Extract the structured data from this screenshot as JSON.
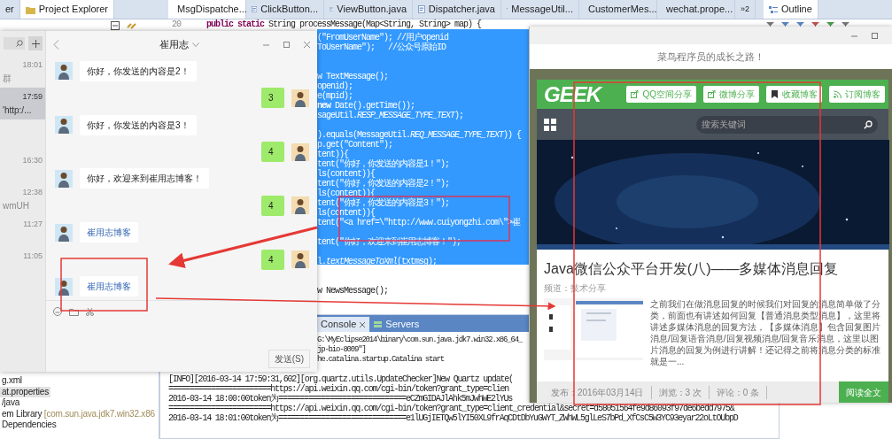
{
  "ide": {
    "left_tabs": [
      {
        "label": "er",
        "selected": false
      },
      {
        "label": "Project Explorer",
        "selected": true
      }
    ],
    "editor_tabs": [
      {
        "label": "MsgDispatche...",
        "selected": true
      },
      {
        "label": "ClickButton...",
        "selected": false
      },
      {
        "label": "ViewButton.java",
        "selected": false
      },
      {
        "label": "Dispatcher.java",
        "selected": false
      },
      {
        "label": "MessageUtil...",
        "selected": false
      },
      {
        "label": "CustomerMes...",
        "selected": false
      },
      {
        "label": "wechat.prope...",
        "selected": false
      }
    ],
    "tab_overflow": "»2",
    "outline_tab": "Outline",
    "code": {
      "line_number": "20",
      "header": "**public static** String processMessage(Map<String, String> map) {",
      "lines": [
        {
          "text": "(\"FromUserName\"); //用户openid",
          "selected": true
        },
        {
          "text": "ToUserName\");   //公众号原始ID",
          "selected": true
        },
        {
          "text": "w TextMessage();",
          "selected": true
        },
        {
          "text": "openid);",
          "selected": true
        },
        {
          "text": "e(mpid);",
          "selected": true
        },
        {
          "text": "**new** Date().getTime());",
          "selected": true
        },
        {
          "text": "sageUtil.*RESP_MESSAGE_TYPE_TEXT*);",
          "selected": true
        },
        {
          "text": ").equals(MessageUtil.*REQ_MESSAGE_TYPE_TEXT*)) {",
          "selected": true
        },
        {
          "text": "p.get(\"Content\");",
          "selected": true
        },
        {
          "text": "tent)){",
          "selected": true
        },
        {
          "text": "tent(\"你好，你发送的内容是1！\");",
          "selected": true
        },
        {
          "text": "ls(content)){",
          "selected": true
        },
        {
          "text": "tent(\"你好，你发送的内容是2！\");",
          "selected": true
        },
        {
          "text": "ls(content)){",
          "selected": true
        },
        {
          "text": "tent(\"你好，你发送的内容是3！\");",
          "selected": true
        },
        {
          "text": "ls(content)){",
          "selected": true
        },
        {
          "text": "tent(\"<a href=\\\"http://www.cuiyongzhi.com\\\">崔",
          "selected": true
        },
        {
          "text": "tent(\"你好，欢迎来到崔用志博客！\");",
          "selected": true
        },
        {
          "text": "l.*textMessageToXml*(txtmsg);",
          "selected": true
        },
        {
          "text": "w NewsMessage();",
          "selected": false
        }
      ]
    },
    "console": {
      "tabs": [
        {
          "label": "Console",
          "selected": true
        },
        {
          "label": "Servers",
          "selected": false
        }
      ],
      "header_lines": [
        "G:\\MyEclipse2014\\binary\\com.sun.java.jdk7.win32.x86_64_",
        "jp-bio-8009\"]",
        "he.catalina.startup.Catalina start"
      ],
      "log_lines": [
        "[INFO][2016-03-14 17:59:31,602][org.quartz.utils.UpdateChecker]New Quartz update(",
        "========================https://api.weixin.qq.com/cgi-bin/token?grant_type=clien",
        "2016-03-14 18:00:00token为==============================eCZmGIDAJlAhk5mJwhWE2lYUs",
        "========================https://api.weixin.qq.com/cgi-bin/token?grant_type=client_credential&secret=d58051564fe9d86093f97de6bedd7975&",
        "2016-03-14 18:01:00token为==============================e1lUGjIETQw5lYI50XL9frAqCDtDbYuGWYT_ZWhWL5glLeS7bPd_XfCsC5W3YC93eyar22oLtOUbpD"
      ]
    },
    "project_tree": [
      {
        "label": "g.xml",
        "selected": false
      },
      {
        "label": "at.properties",
        "selected": true
      },
      {
        "label": "/java",
        "selected": false
      },
      {
        "label": "em Library",
        "detail": "[com.sun.java.jdk7.win32.x86",
        "selected": false
      },
      {
        "label": "Dependencies",
        "selected": false
      }
    ]
  },
  "chat_window": {
    "title": "崔用志",
    "conversations": [
      {
        "time": "18:01",
        "preview": "群",
        "selected": false
      },
      {
        "time": "17:59",
        "preview": "'http:/...",
        "selected": true
      },
      {
        "time": "16:30",
        "selected": false
      },
      {
        "time": "12:38",
        "preview": "wmUH",
        "selected": false
      },
      {
        "time": "11:27",
        "selected": false
      },
      {
        "time": "11:05",
        "selected": false
      }
    ],
    "messages": [
      {
        "kind": "text",
        "sent": false,
        "text": "你好，你发送的内容是2！"
      },
      {
        "kind": "text",
        "sent": true,
        "text": "3"
      },
      {
        "kind": "text",
        "sent": false,
        "text": "你好，你发送的内容是3！"
      },
      {
        "kind": "text",
        "sent": true,
        "text": "4"
      },
      {
        "kind": "text",
        "sent": false,
        "text": "你好，欢迎来到崔用志博客！"
      },
      {
        "kind": "text",
        "sent": true,
        "text": "4"
      },
      {
        "kind": "link",
        "sent": false,
        "text": "崔用志博客"
      },
      {
        "kind": "text",
        "sent": true,
        "text": "4"
      },
      {
        "kind": "link",
        "sent": false,
        "text": "崔用志博客"
      }
    ],
    "send_button": "发送(S)"
  },
  "browser": {
    "tagline": "菜鸟程序员的成长之路！",
    "logo": "GEEK",
    "share_buttons": [
      {
        "kind": "share",
        "label": "QQ空间分享"
      },
      {
        "kind": "share",
        "label": "微博分享"
      },
      {
        "kind": "bookmark",
        "label": "收藏博客"
      },
      {
        "kind": "feed",
        "label": "订阅博客"
      }
    ],
    "search": {
      "placeholder": "搜索关键词"
    },
    "post": {
      "title": "Java微信公众平台开发(八)——多媒体消息回复",
      "category": "频道：技术分享",
      "excerpt": "之前我们在做消息回复的时候我们对回复的消息简单做了分类，前面也有讲述如何回复【普通消息类型消息】，这里将讲述多媒体消息的回复方法，【多媒体消息】包含回复图片消息/回复语音消息/回复视频消息/回复音乐消息，这里以图片消息的回复为例进行讲解！还记得之前将消息分类的标准就是一...",
      "date": "发布：2016年03月14日",
      "views": "浏览：3 次",
      "comments": "评论：0 条",
      "read_more": "阅读全文"
    }
  }
}
